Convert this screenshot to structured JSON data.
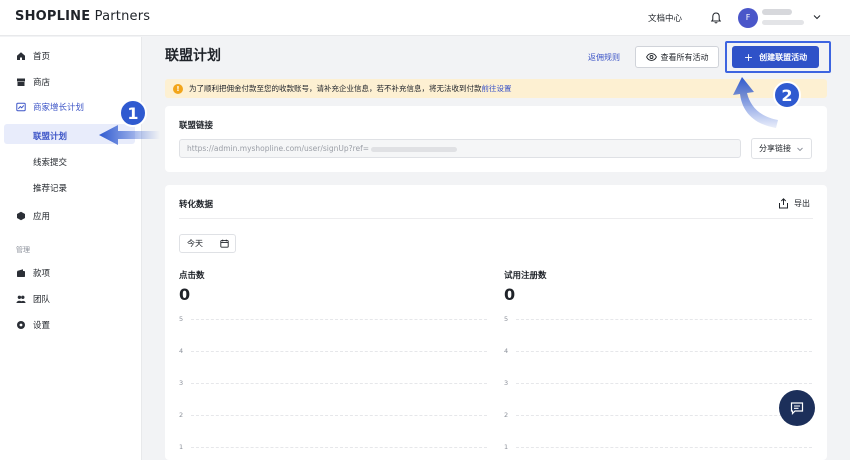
{
  "brand": {
    "logo_bold": "SHOPLINE",
    "logo_light": " Partners"
  },
  "topbar": {
    "docs_label": "文档中心",
    "avatar_initial": "F"
  },
  "sidebar": {
    "items": [
      {
        "label": "首页",
        "icon": "home-icon"
      },
      {
        "label": "商店",
        "icon": "store-icon"
      },
      {
        "label": "商家增长计划",
        "icon": "chart-icon"
      },
      {
        "label": "联盟计划"
      },
      {
        "label": "线索提交"
      },
      {
        "label": "推荐记录"
      },
      {
        "label": "应用",
        "icon": "app-icon"
      }
    ],
    "section_label": "管理",
    "manage_items": [
      {
        "label": "款项",
        "icon": "wallet-icon"
      },
      {
        "label": "团队",
        "icon": "team-icon"
      },
      {
        "label": "设置",
        "icon": "settings-icon"
      }
    ]
  },
  "header": {
    "title": "联盟计划",
    "rules_link": "返佣规则",
    "view_all_label": "查看所有活动",
    "create_label": "创建联盟活动"
  },
  "alert": {
    "text": "为了顺利把佣金付款至您的收款账号，请补充企业信息，若不补充信息，将无法收到付款",
    "link": "前往设置"
  },
  "referral": {
    "title": "联盟链接",
    "url_prefix": "https://admin.myshopline.com/user/signUp?ref=",
    "share_label": "分享链接"
  },
  "conversion": {
    "title": "转化数据",
    "export_label": "导出",
    "date_filter": "今天",
    "metrics": [
      {
        "label": "点击数",
        "value": "0"
      },
      {
        "label": "试用注册数",
        "value": "0"
      }
    ],
    "y_ticks": [
      "5",
      "4",
      "3",
      "2",
      "1"
    ]
  },
  "callouts": {
    "step1": "1",
    "step2": "2"
  },
  "colors": {
    "accent": "#2f52c8",
    "alert_bg": "#fdf0d2",
    "active_bg": "#e8ecfb",
    "fab": "#1c2f5a"
  }
}
